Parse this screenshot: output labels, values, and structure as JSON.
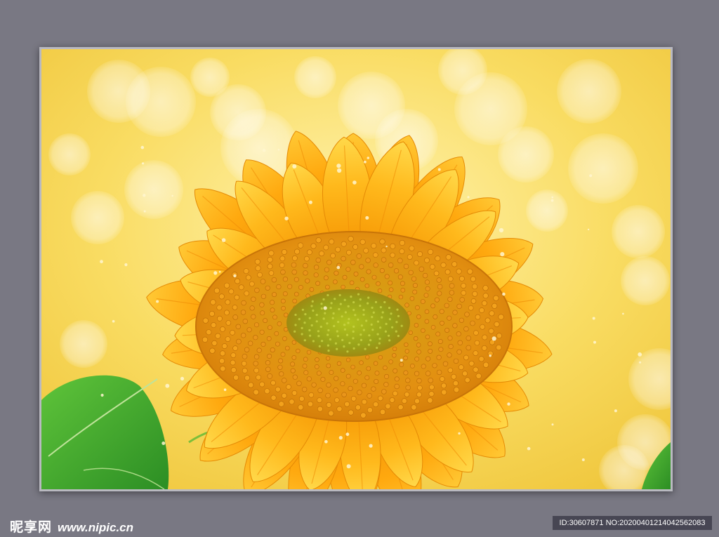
{
  "watermark": {
    "brand": "昵享网",
    "url": "www.nipic.cn"
  },
  "image_id": {
    "text": "ID:30607871 NO:20200401214042562083"
  },
  "colors": {
    "background": "#797883",
    "frame_border": "#b9b9c0",
    "petal": "#ffb21a",
    "center": "#d88a10",
    "disk_green": "#9aa81c",
    "leaf": "#3aa52a",
    "bokeh_bg": "#f5d24a",
    "id_bar": "#474653"
  }
}
